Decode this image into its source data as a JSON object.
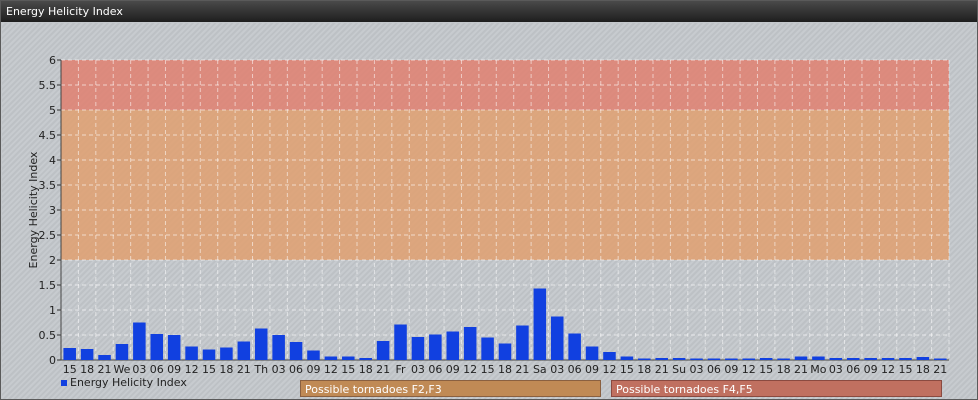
{
  "window": {
    "title": "Energy Helicity Index"
  },
  "legend": {
    "label": "Energy Helicity Index",
    "color": "#1140e0"
  },
  "bands": [
    {
      "label": "Possible tornadoes F2,F3",
      "from": 2,
      "to": 5,
      "color": "#e0a070"
    },
    {
      "label": "Possible tornadoes F4,F5",
      "from": 5,
      "to": 6,
      "color": "#e08070"
    }
  ],
  "chart_data": {
    "type": "bar",
    "ylabel": "Energy Helicity Index",
    "ylim": [
      0,
      6
    ],
    "yticks": [
      "0",
      "0.5",
      "1",
      "1.5",
      "2",
      "2.5",
      "3",
      "3.5",
      "4",
      "4.5",
      "5",
      "5.5",
      "6"
    ],
    "grid": true,
    "categories": [
      "15",
      "18",
      "21",
      "We",
      "03",
      "06",
      "09",
      "12",
      "15",
      "18",
      "21",
      "Th",
      "03",
      "06",
      "09",
      "12",
      "15",
      "18",
      "21",
      "Fr",
      "03",
      "06",
      "09",
      "12",
      "15",
      "18",
      "21",
      "Sa",
      "03",
      "06",
      "09",
      "12",
      "15",
      "18",
      "21",
      "Su",
      "03",
      "06",
      "09",
      "12",
      "15",
      "18",
      "21",
      "Mo",
      "03",
      "06",
      "09",
      "12",
      "15",
      "18",
      "21"
    ],
    "series": [
      {
        "name": "Energy Helicity Index",
        "values": [
          0.24,
          0.22,
          0.1,
          0.32,
          0.75,
          0.52,
          0.5,
          0.27,
          0.21,
          0.25,
          0.37,
          0.63,
          0.5,
          0.36,
          0.19,
          0.07,
          0.07,
          0.04,
          0.38,
          0.71,
          0.46,
          0.51,
          0.57,
          0.66,
          0.45,
          0.33,
          0.69,
          1.43,
          0.87,
          0.53,
          0.27,
          0.16,
          0.07,
          0.03,
          0.04,
          0.04,
          0.03,
          0.03,
          0.03,
          0.03,
          0.04,
          0.03,
          0.07,
          0.07,
          0.04,
          0.04,
          0.04,
          0.04,
          0.04,
          0.06,
          0.03
        ]
      }
    ]
  }
}
